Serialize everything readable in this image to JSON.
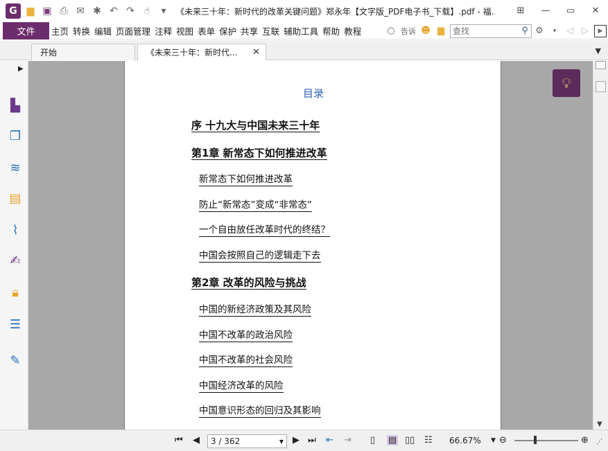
{
  "window": {
    "title": "《未来三十年：新时代的改革关键问题》郑永年【文字版_PDF电子书_下载】.pdf - 福..."
  },
  "menu": {
    "file_label": "文件",
    "items": [
      "主页",
      "转换",
      "编辑",
      "页面管理",
      "注释",
      "视图",
      "表单",
      "保护",
      "共享",
      "互联",
      "辅助工具",
      "帮助",
      "教程"
    ],
    "tell_label": "告诉",
    "search_placeholder": "查找"
  },
  "tabs": {
    "home_label": "开始",
    "doc_label": "《未来三十年：新时代..."
  },
  "document": {
    "toc_title": "目录",
    "entries": [
      {
        "text": "序 十九大与中国未来三十年",
        "level": "chapter"
      },
      {
        "text": "第1章 新常态下如何推进改革",
        "level": "chapter"
      },
      {
        "text": "新常态下如何推进改革",
        "level": "section"
      },
      {
        "text": "防止“新常态”变成“非常态”",
        "level": "section"
      },
      {
        "text": "一个自由放任改革时代的终结？",
        "level": "section"
      },
      {
        "text": "中国会按照自己的逻辑走下去",
        "level": "section"
      },
      {
        "text": "第2章 改革的风险与挑战",
        "level": "chapter"
      },
      {
        "text": "中国的新经济政策及其风险",
        "level": "section"
      },
      {
        "text": "中国不改革的政治风险",
        "level": "section"
      },
      {
        "text": "中国不改革的社会风险",
        "level": "section"
      },
      {
        "text": "中国经济改革的风险",
        "level": "section"
      },
      {
        "text": "中国意识形态的回归及其影响",
        "level": "section"
      }
    ]
  },
  "statusbar": {
    "page_indicator": "3 / 362",
    "zoom": "66.67%"
  },
  "colors": {
    "accent": "#6b2d6b",
    "toc_title": "#3060b0",
    "canvas": "#a8a8a8"
  }
}
